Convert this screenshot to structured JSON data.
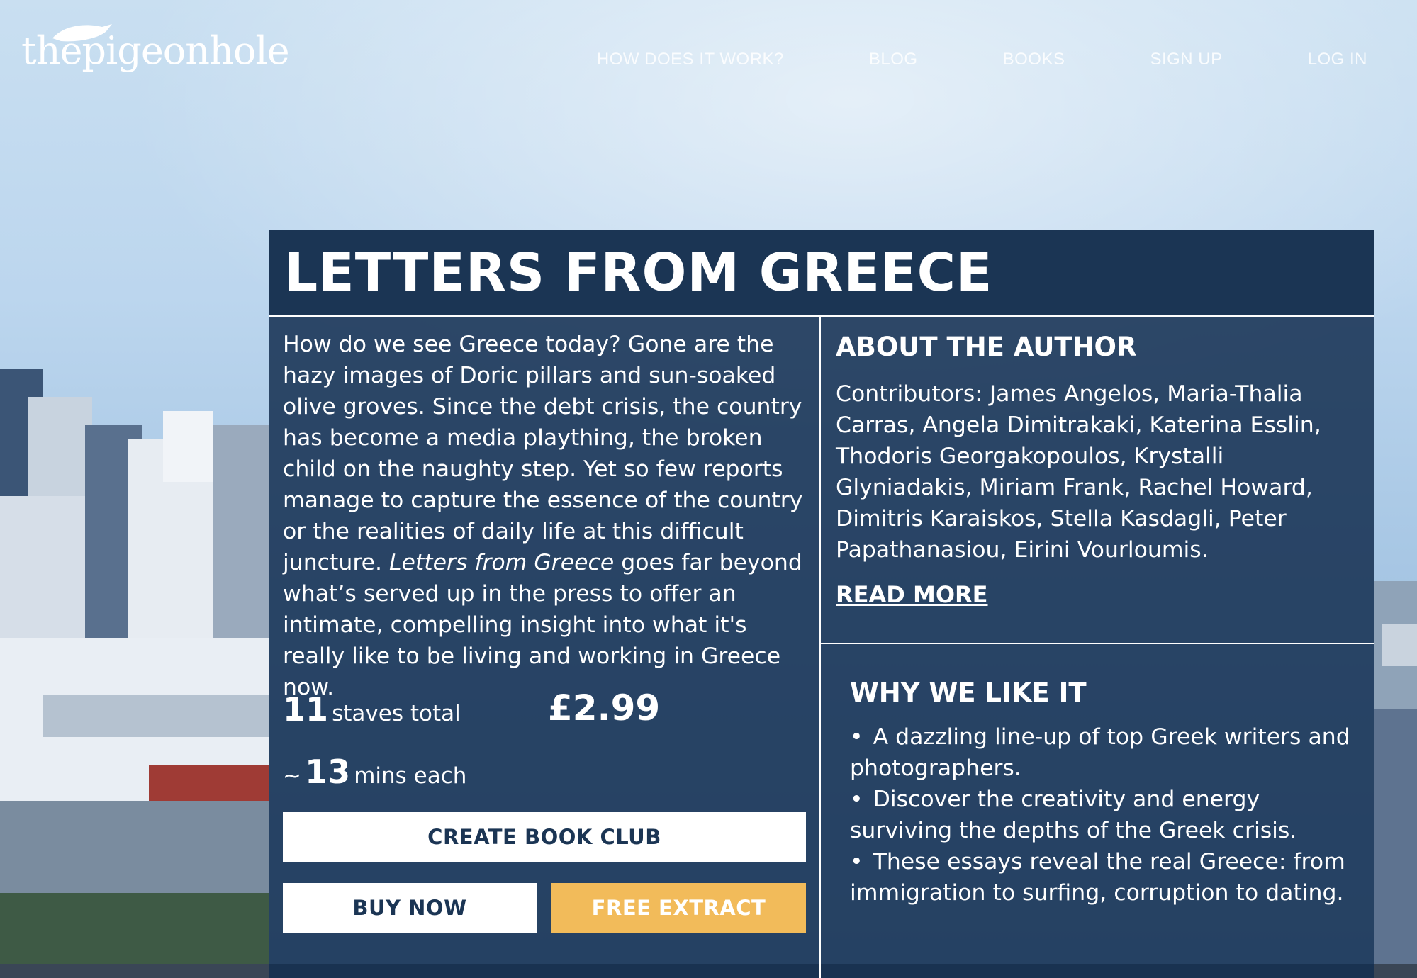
{
  "header": {
    "logo": "thepigeonhole",
    "nav": [
      "HOW DOES IT WORK?",
      "BLOG",
      "BOOKS",
      "SIGN UP",
      "LOG IN"
    ]
  },
  "book": {
    "title": "LETTERS FROM GREECE",
    "description_1": "How do we see Greece today? Gone are the hazy images of Doric pillars and sun-soaked olive groves. Since the debt crisis, the country has become a media plaything, the broken child on the naughty step. Yet so few reports manage to capture the essence of the country or the realities of daily life at this difficult juncture.",
    "description_italic": "Letters from Greece",
    "description_2": " goes far beyond what’s served up in the press to offer an intimate, compelling insight into what it's really like to be living and working in Greece now.",
    "staves_count": "11",
    "staves_label": "staves total",
    "mins_prefix": "~",
    "mins_count": "13",
    "mins_label": "mins each",
    "price": "£2.99",
    "btn_club": "CREATE BOOK CLUB",
    "btn_buy": "BUY NOW",
    "btn_extract": "FREE EXTRACT"
  },
  "about": {
    "heading": "ABOUT THE AUTHOR",
    "text": "Contributors: James Angelos, Maria-Thalia Carras, Angela Dimitrakaki, Katerina Esslin, Thodoris Georgakopoulos, Krystalli Glyniadakis, Miriam Frank, Rachel Howard, Dimitris Karaiskos, Stella Kasdagli, Peter Papathanasiou, Eirini Vourloumis.",
    "read_more": "READ MORE"
  },
  "why": {
    "heading": "WHY WE LIKE IT",
    "items": [
      "A dazzling line-up of top Greek writers and photographers.",
      "Discover the creativity and energy surviving the depths of the Greek crisis.",
      "These essays reveal the real Greece: from immigration to surfing, corruption to dating."
    ]
  },
  "colors": {
    "panel": "#1b3554",
    "accent_button": "#f2bb5a",
    "button_text": "#1b3554"
  }
}
